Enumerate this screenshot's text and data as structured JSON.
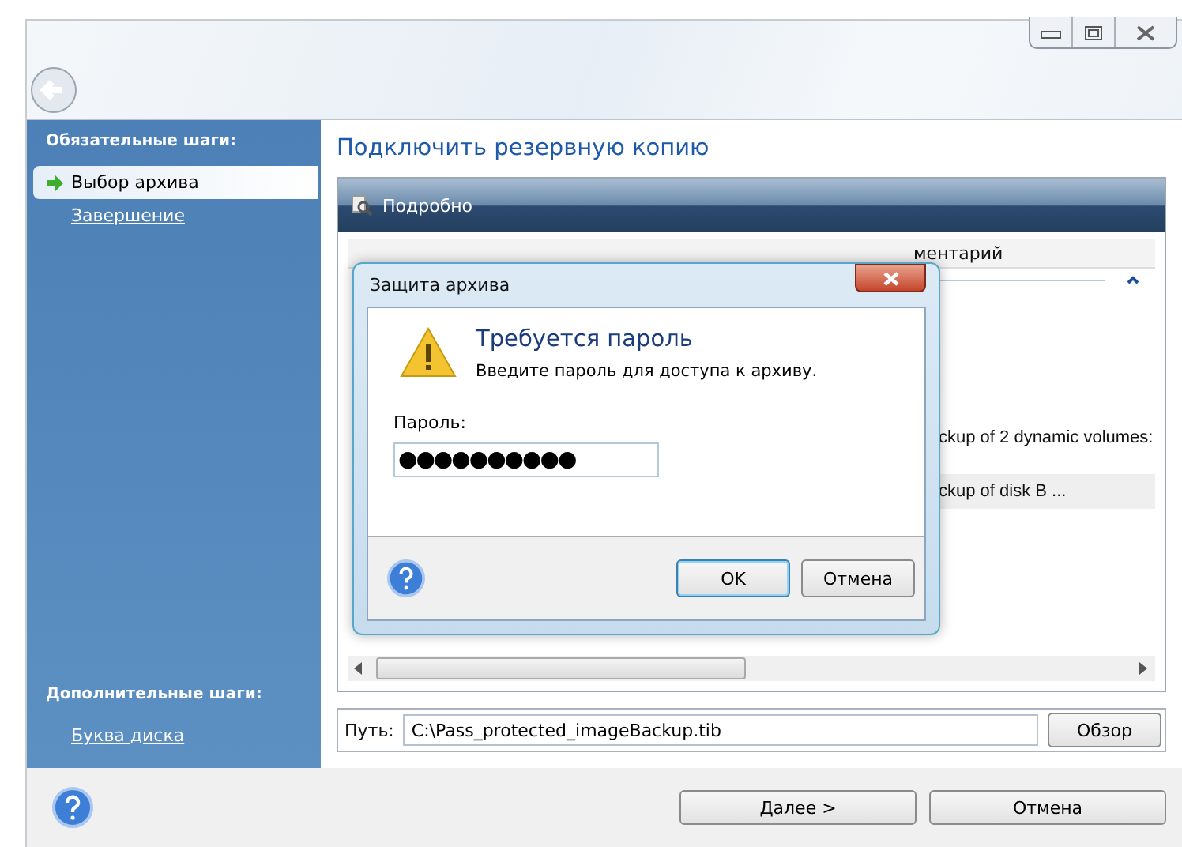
{
  "sidebar": {
    "sections": [
      {
        "title": "Обязательные шаги:",
        "items": [
          {
            "label": "Выбор архива",
            "selected": true
          },
          {
            "label": "Завершение",
            "selected": false
          }
        ]
      },
      {
        "title": "Дополнительные шаги:",
        "items": [
          {
            "label": "Буква диска",
            "selected": false
          }
        ]
      }
    ]
  },
  "main": {
    "title": "Подключить резервную копию",
    "panel": {
      "header": "Подробно",
      "table": {
        "column_3": "ментарий",
        "rows": [
          {
            "column_3": ""
          },
          {
            "column_3": "ckup of 2 dynamic volumes:"
          },
          {
            "column_3": "ckup of disk B ..."
          }
        ]
      }
    },
    "path": {
      "label": "Путь:",
      "value": "C:\\Pass_protected_imageBackup.tib",
      "browse_button": "Обзор"
    }
  },
  "buttons": [
    {
      "label": "Далее >"
    },
    {
      "label": "Отмена"
    }
  ],
  "dialog": {
    "title": "Защита архива",
    "heading": "Требуется пароль",
    "message": "Введите пароль для доступа к архиву.",
    "password_label": "Пароль:",
    "password_value": "●●●●●●●●●●",
    "buttons": [
      {
        "label": "OK",
        "default": true
      },
      {
        "label": "Отмена",
        "default": false
      }
    ]
  }
}
